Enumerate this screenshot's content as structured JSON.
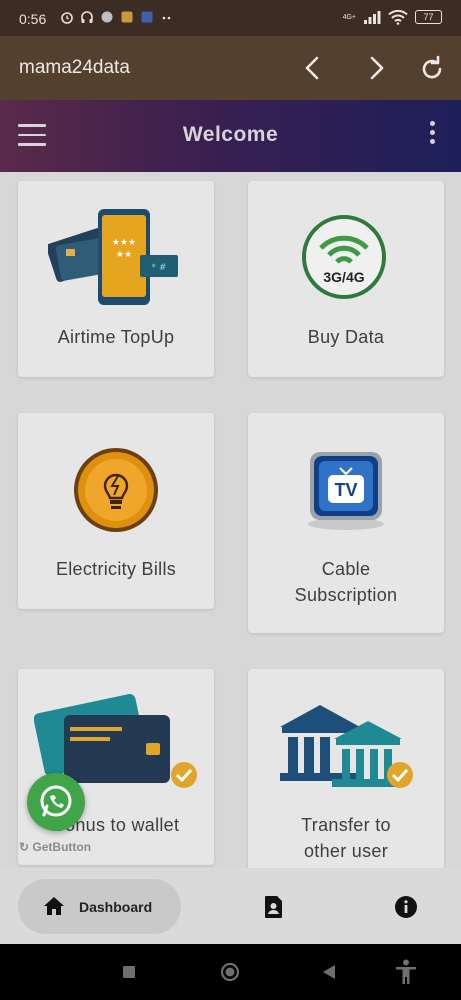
{
  "status_bar": {
    "time": "0:56",
    "battery": "77",
    "signal_label": "4G+"
  },
  "browser": {
    "site_name": "mama24data"
  },
  "app_bar": {
    "title": "Welcome"
  },
  "services": [
    {
      "label": "Airtime TopUp"
    },
    {
      "label": "Buy Data",
      "icon_text": "3G/4G"
    },
    {
      "label": "Electricity Bills"
    },
    {
      "label": "Cable Subscription",
      "icon_text": "TV"
    },
    {
      "label": "Bonus to wallet"
    },
    {
      "label": "Transfer to other user"
    }
  ],
  "widget": {
    "getbutton_label": "GetButton"
  },
  "bottom_nav": {
    "dashboard_label": "Dashboard"
  },
  "colors": {
    "appbar_start": "#5a2a4a",
    "appbar_end": "#1d1f5a",
    "whatsapp": "#3fa548"
  }
}
